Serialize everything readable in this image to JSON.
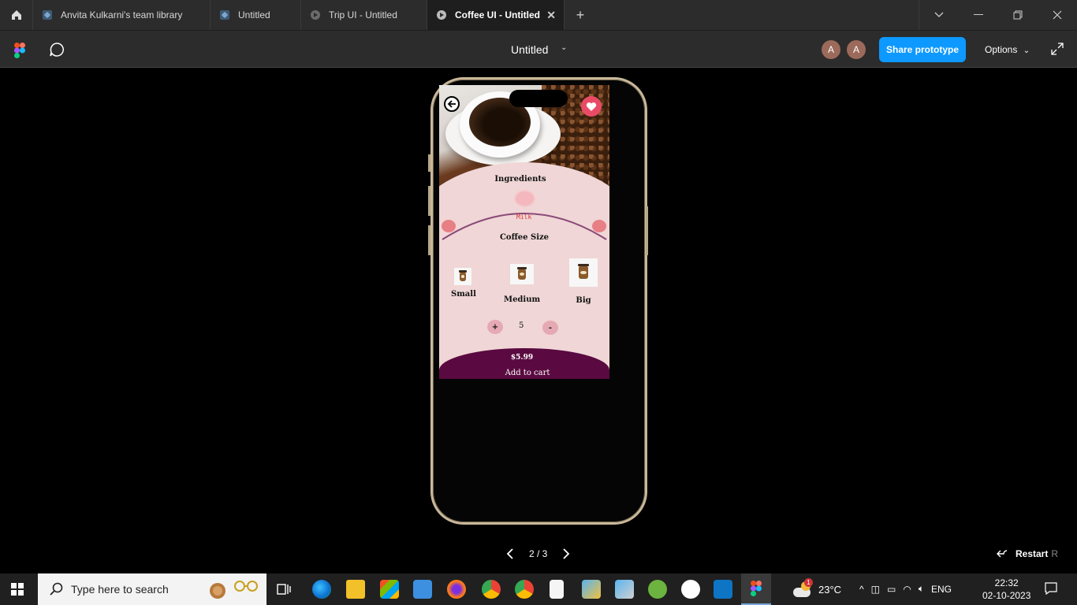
{
  "tabs": [
    {
      "label": "Anvita Kulkarni's team library",
      "icon": "library-icon"
    },
    {
      "label": "Untitled",
      "icon": "library-icon"
    },
    {
      "label": "Trip UI - Untitled",
      "icon": "prototype-play-icon"
    },
    {
      "label": "Coffee UI - Untitled",
      "icon": "prototype-play-icon",
      "active": true
    }
  ],
  "toolbar": {
    "doc_title": "Untitled",
    "avatars": [
      "A",
      "A"
    ],
    "share_label": "Share prototype",
    "options_label": "Options"
  },
  "app": {
    "ingredients_label": "Ingredients",
    "ingredient_selected": "Milk",
    "size_label": "Coffee Size",
    "sizes": [
      "Small",
      "Medium",
      "Big"
    ],
    "plus": "+",
    "quantity": "5",
    "minus": "-",
    "price": "$5.99",
    "cart_label": "Add to cart",
    "colors": {
      "accent": "#5a0a40",
      "background": "#f0d6d6",
      "heart": "#e94b66"
    }
  },
  "pager": {
    "text": "2 / 3",
    "restart_label": "Restart",
    "restart_key": "R"
  },
  "taskbar": {
    "search_placeholder": "Type here to search",
    "temperature": "23°C",
    "language": "ENG",
    "time": "22:32",
    "date": "02-10-2023",
    "weather_badge": "1"
  }
}
